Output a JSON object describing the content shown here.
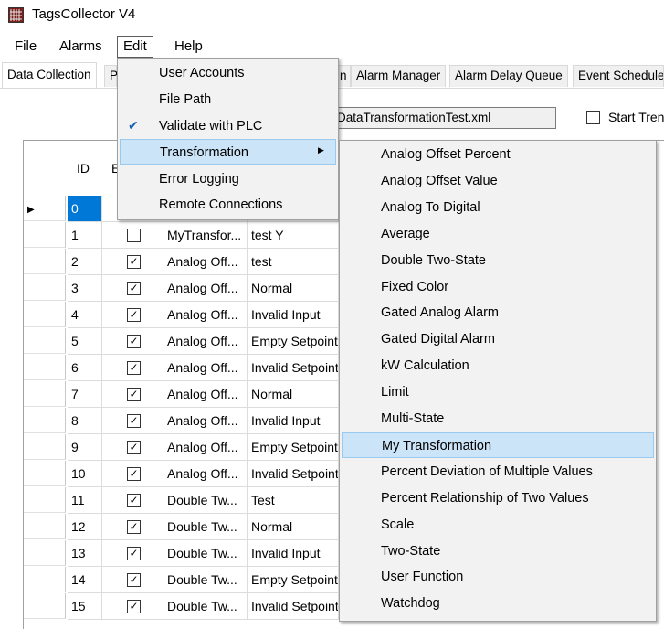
{
  "window": {
    "title": "TagsCollector V4"
  },
  "menubar": {
    "file": "File",
    "alarms": "Alarms",
    "edit": "Edit",
    "help": "Help"
  },
  "tabs": [
    "Data Collection",
    "P",
    "n",
    "Alarm Manager",
    "Alarm Delay Queue",
    "Event Schedule"
  ],
  "file_path": "DataTransformationTest.xml",
  "start_trend_label": "Start Tren",
  "grid": {
    "headers": {
      "id": "ID",
      "enabled": "E"
    },
    "rows": [
      {
        "id": "0",
        "checked": null,
        "type": "",
        "name": ""
      },
      {
        "id": "1",
        "checked": false,
        "type": "MyTransfor...",
        "name": "test Y"
      },
      {
        "id": "2",
        "checked": true,
        "type": "Analog Off...",
        "name": "test"
      },
      {
        "id": "3",
        "checked": true,
        "type": "Analog Off...",
        "name": "Normal"
      },
      {
        "id": "4",
        "checked": true,
        "type": "Analog Off...",
        "name": "Invalid Input"
      },
      {
        "id": "5",
        "checked": true,
        "type": "Analog Off...",
        "name": "Empty Setpoint"
      },
      {
        "id": "6",
        "checked": true,
        "type": "Analog Off...",
        "name": "Invalid Setpoint"
      },
      {
        "id": "7",
        "checked": true,
        "type": "Analog Off...",
        "name": "Normal"
      },
      {
        "id": "8",
        "checked": true,
        "type": "Analog Off...",
        "name": "Invalid Input"
      },
      {
        "id": "9",
        "checked": true,
        "type": "Analog Off...",
        "name": "Empty Setpoint"
      },
      {
        "id": "10",
        "checked": true,
        "type": "Analog Off...",
        "name": "Invalid Setpoint"
      },
      {
        "id": "11",
        "checked": true,
        "type": "Double Tw...",
        "name": "Test"
      },
      {
        "id": "12",
        "checked": true,
        "type": "Double Tw...",
        "name": "Normal"
      },
      {
        "id": "13",
        "checked": true,
        "type": "Double Tw...",
        "name": "Invalid Input"
      },
      {
        "id": "14",
        "checked": true,
        "type": "Double Tw...",
        "name": "Empty Setpoint"
      },
      {
        "id": "15",
        "checked": true,
        "type": "Double Tw...",
        "name": "Invalid Setpoint"
      }
    ]
  },
  "edit_menu": {
    "items": [
      "User Accounts",
      "File Path",
      "Validate with PLC",
      "Transformation",
      "Error Logging",
      "Remote Connections"
    ],
    "checked_item": "Validate with PLC",
    "highlighted_item": "Transformation"
  },
  "transformation_submenu": {
    "items": [
      "Analog Offset Percent",
      "Analog Offset Value",
      "Analog To Digital",
      "Average",
      "Double Two-State",
      "Fixed Color",
      "Gated Analog Alarm",
      "Gated Digital Alarm",
      "kW Calculation",
      "Limit",
      "Multi-State",
      "My Transformation",
      "Percent Deviation of Multiple Values",
      "Percent Relationship of Two Values",
      "Scale",
      "Two-State",
      "User Function",
      "Watchdog"
    ],
    "highlighted_item": "My Transformation"
  },
  "colors": {
    "selection": "#0078d7",
    "menu_highlight": "#cce4f7",
    "menu_bg": "#f2f2f2"
  }
}
